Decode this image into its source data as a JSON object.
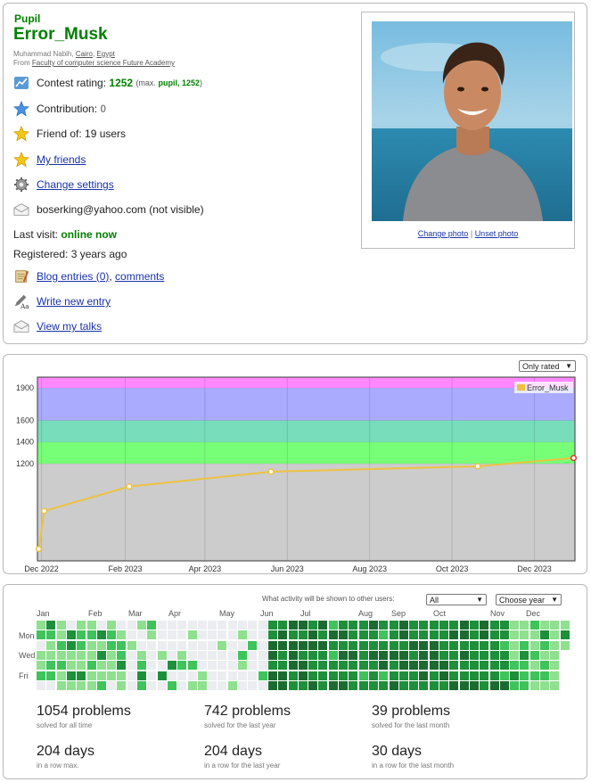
{
  "profile": {
    "rank": "Pupil",
    "handle": "Error_Musk",
    "name_prefix": "Muhammad Nabih,",
    "city": "Cairo",
    "country": "Egypt",
    "from_prefix": "From",
    "org": "Faculty of computer science Future Academy",
    "contest_rating_label": "Contest rating:",
    "contest_rating": "1252",
    "max_prefix": "(max.",
    "max_rank": "pupil",
    "max_rating": "1252",
    "max_suffix": ")",
    "contribution_label": "Contribution:",
    "contribution": "0",
    "friend_of": "Friend of: 19 users",
    "my_friends": "My friends",
    "change_settings": "Change settings",
    "email": "boserking@yahoo.com (not visible)",
    "last_visit_label": "Last visit:",
    "last_visit": "online now",
    "registered": "Registered: 3 years ago",
    "blog_entries": "Blog entries (0)",
    "comments": "comments",
    "write_new_entry": "Write new entry",
    "view_talks": "View my talks",
    "change_photo": "Change photo",
    "unset_photo": "Unset photo",
    "photo_sep": "|"
  },
  "rating_graph": {
    "filter_selected": "Only rated",
    "legend": "Error_Musk"
  },
  "chart_data": {
    "type": "line",
    "series": [
      {
        "name": "Error_Musk",
        "x": [
          "2022-11-29",
          "2022-12-03",
          "2023-02-04",
          "2023-05-20",
          "2023-10-20",
          "2023-12-30"
        ],
        "y": [
          410,
          762,
          988,
          1125,
          1175,
          1252
        ]
      }
    ],
    "xticks": [
      "Dec 2022",
      "Feb 2023",
      "Apr 2023",
      "Jun 2023",
      "Aug 2023",
      "Oct 2023",
      "Dec 2023"
    ],
    "yticks": [
      1200,
      1400,
      1600,
      1900
    ],
    "ylim": [
      300,
      2000
    ],
    "bands": [
      {
        "from": 0,
        "to": 1200,
        "color": "#cccccc"
      },
      {
        "from": 1200,
        "to": 1400,
        "color": "#77ff77"
      },
      {
        "from": 1400,
        "to": 1600,
        "color": "#77ddbb"
      },
      {
        "from": 1600,
        "to": 1900,
        "color": "#aaaaff"
      },
      {
        "from": 1900,
        "to": 2000,
        "color": "#ff88ff"
      }
    ],
    "line_color": "#edc240"
  },
  "activity": {
    "visibility_label": "What activity will be shown to other users:",
    "visibility_selected": "All",
    "year_selected": "Choose year",
    "months": [
      "Jan",
      "Feb",
      "Mar",
      "Apr",
      "May",
      "Jun",
      "Jul",
      "Aug",
      "Sep",
      "Oct",
      "Nov",
      "Dec"
    ],
    "days": [
      "Mon",
      "Wed",
      "Fri"
    ],
    "colors": [
      "#ebedf0",
      "#8fe08f",
      "#3fc35b",
      "#1e8f3a",
      "#1b6b30"
    ],
    "stats": [
      {
        "num": "1054 problems",
        "label": "solved for all time"
      },
      {
        "num": "742 problems",
        "label": "solved for the last year"
      },
      {
        "num": "39 problems",
        "label": "solved for the last month"
      },
      {
        "num": "204 days",
        "label": "in a row max."
      },
      {
        "num": "204 days",
        "label": "in a row for the last year"
      },
      {
        "num": "30 days",
        "label": "in a row for the last month"
      }
    ]
  }
}
